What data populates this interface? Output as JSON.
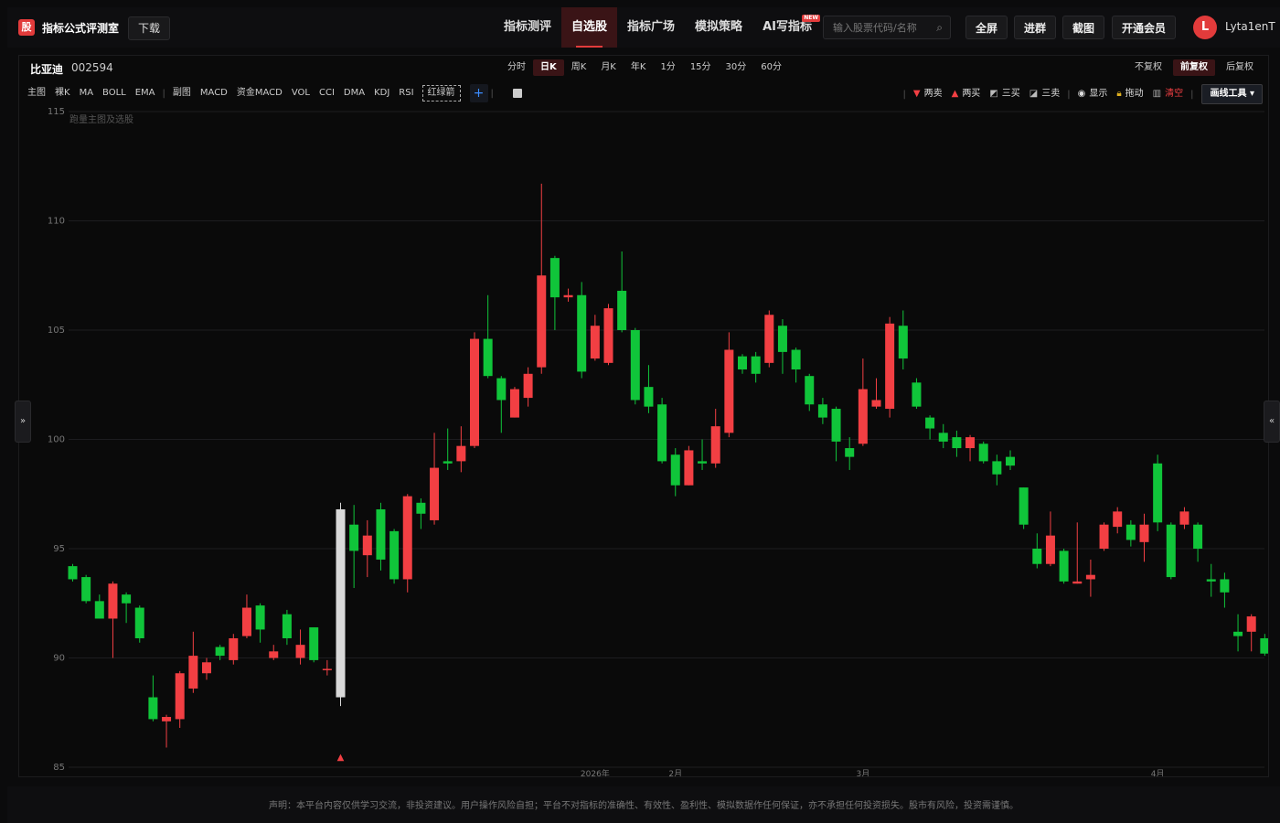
{
  "brand": {
    "logo": "股",
    "name": "指标公式评测室"
  },
  "header": {
    "download_label": "下载",
    "nav": [
      {
        "label": "指标测评",
        "active": false,
        "badge": ""
      },
      {
        "label": "自选股",
        "active": true,
        "badge": ""
      },
      {
        "label": "指标广场",
        "active": false,
        "badge": ""
      },
      {
        "label": "模拟策略",
        "active": false,
        "badge": ""
      },
      {
        "label": "AI写指标",
        "active": false,
        "badge": "NEW"
      }
    ],
    "search_placeholder": "输入股票代码/名称",
    "buttons": {
      "fullscreen": "全屏",
      "join_group": "进群",
      "screenshot": "截图",
      "vip": "开通会员"
    },
    "user": {
      "initial": "L",
      "name": "Lyta1enT"
    }
  },
  "stock": {
    "name": "比亚迪",
    "code": "002594"
  },
  "periods": [
    {
      "label": "分时",
      "active": false
    },
    {
      "label": "日K",
      "active": true
    },
    {
      "label": "周K",
      "active": false
    },
    {
      "label": "月K",
      "active": false
    },
    {
      "label": "年K",
      "active": false
    },
    {
      "label": "1分",
      "active": false
    },
    {
      "label": "15分",
      "active": false
    },
    {
      "label": "30分",
      "active": false
    },
    {
      "label": "60分",
      "active": false
    }
  ],
  "adjust": [
    {
      "label": "不复权",
      "active": false
    },
    {
      "label": "前复权",
      "active": true
    },
    {
      "label": "后复权",
      "active": false
    }
  ],
  "indicators_main": [
    "主图",
    "裸K",
    "MA",
    "BOLL",
    "EMA"
  ],
  "indicators_sub": [
    "副图",
    "MACD",
    "资金MACD",
    "VOL",
    "CCI",
    "DMA",
    "KDJ",
    "RSI"
  ],
  "indicator_dashed": "红绿箭",
  "tools": {
    "sell2": "两卖",
    "buy2": "两买",
    "buy3": "三买",
    "sell3": "三卖",
    "show": "显示",
    "drag": "拖动",
    "clear": "清空",
    "draw_tools": "画线工具"
  },
  "side": {
    "expand_left": "»",
    "expand_right": "«"
  },
  "footer": "声明：本平台内容仅供学习交流，非投资建议。用户操作风险自担；平台不对指标的准确性、有效性、盈利性、模拟数据作任何保证，亦不承担任何投资损失。股市有风险，投资需谨慎。",
  "colors": {
    "up": "#f23f43",
    "down": "#10c53a",
    "accent": "#e23b3b",
    "highlight": "#d9d9d9"
  },
  "chart_data": {
    "type": "candlestick",
    "watermark": "跑量主图及选股",
    "ylim": [
      85,
      115
    ],
    "yticks": [
      85,
      90,
      95,
      100,
      105,
      110,
      115
    ],
    "xticks": [
      {
        "label": "2026年",
        "index": 39
      },
      {
        "label": "2月",
        "index": 45
      },
      {
        "label": "3月",
        "index": 59
      },
      {
        "label": "4月",
        "index": 81
      }
    ],
    "marker": {
      "index": 20,
      "symbol": "▲",
      "color": "#f23f43"
    },
    "highlight_index": 20,
    "candles": [
      [
        94.2,
        93.6,
        94.3,
        93.5
      ],
      [
        93.7,
        92.6,
        93.8,
        92.5
      ],
      [
        92.6,
        91.8,
        92.9,
        91.8
      ],
      [
        91.8,
        93.4,
        93.5,
        90.0
      ],
      [
        92.9,
        92.5,
        93.0,
        91.6
      ],
      [
        92.3,
        90.9,
        92.4,
        90.7
      ],
      [
        88.2,
        87.2,
        89.2,
        87.1
      ],
      [
        87.1,
        87.3,
        87.4,
        85.9
      ],
      [
        87.2,
        89.3,
        89.4,
        86.8
      ],
      [
        88.6,
        90.1,
        91.2,
        88.4
      ],
      [
        89.3,
        89.8,
        90.0,
        89.0
      ],
      [
        90.5,
        90.1,
        90.6,
        89.9
      ],
      [
        89.9,
        90.9,
        91.1,
        89.7
      ],
      [
        91.0,
        92.3,
        92.9,
        90.9
      ],
      [
        92.4,
        91.3,
        92.5,
        90.7
      ],
      [
        90.0,
        90.3,
        90.6,
        89.9
      ],
      [
        92.0,
        90.9,
        92.2,
        90.6
      ],
      [
        90.0,
        90.6,
        91.3,
        89.7
      ],
      [
        91.4,
        89.9,
        91.4,
        89.8
      ],
      [
        89.5,
        89.5,
        89.9,
        89.2
      ],
      [
        96.8,
        88.2,
        97.1,
        87.8
      ],
      [
        96.1,
        94.9,
        97.0,
        93.2
      ],
      [
        94.7,
        95.6,
        96.3,
        93.7
      ],
      [
        96.8,
        94.5,
        97.1,
        94.0
      ],
      [
        95.8,
        93.6,
        95.9,
        93.4
      ],
      [
        93.6,
        97.4,
        97.5,
        93.0
      ],
      [
        97.1,
        96.6,
        97.3,
        95.9
      ],
      [
        96.3,
        98.7,
        100.3,
        96.1
      ],
      [
        99.0,
        98.9,
        100.5,
        98.6
      ],
      [
        99.0,
        99.7,
        100.6,
        98.5
      ],
      [
        99.7,
        104.6,
        104.9,
        99.6
      ],
      [
        104.6,
        102.9,
        106.6,
        102.8
      ],
      [
        102.8,
        101.8,
        102.9,
        100.3
      ],
      [
        101.0,
        102.3,
        102.4,
        101.0
      ],
      [
        101.9,
        103.0,
        103.3,
        101.5
      ],
      [
        103.3,
        107.5,
        111.7,
        103.0
      ],
      [
        108.3,
        106.5,
        108.4,
        105.0
      ],
      [
        106.5,
        106.6,
        106.9,
        106.3
      ],
      [
        106.6,
        103.1,
        107.2,
        102.8
      ],
      [
        103.7,
        105.2,
        105.7,
        103.6
      ],
      [
        103.5,
        106.0,
        106.2,
        103.4
      ],
      [
        106.8,
        105.0,
        108.6,
        104.9
      ],
      [
        105.0,
        101.8,
        105.1,
        101.6
      ],
      [
        102.4,
        101.5,
        103.4,
        101.2
      ],
      [
        101.6,
        99.0,
        101.9,
        98.9
      ],
      [
        99.3,
        97.9,
        99.6,
        97.4
      ],
      [
        97.9,
        99.5,
        99.7,
        97.9
      ],
      [
        99.0,
        98.9,
        100.0,
        98.6
      ],
      [
        98.9,
        100.6,
        101.4,
        98.7
      ],
      [
        100.3,
        104.1,
        104.9,
        100.1
      ],
      [
        103.8,
        103.2,
        103.9,
        103.0
      ],
      [
        103.8,
        103.0,
        104.0,
        102.6
      ],
      [
        103.5,
        105.7,
        105.9,
        103.3
      ],
      [
        105.2,
        104.0,
        105.5,
        103.0
      ],
      [
        104.1,
        103.2,
        104.2,
        102.6
      ],
      [
        102.9,
        101.6,
        103.0,
        101.3
      ],
      [
        101.6,
        101.0,
        101.9,
        100.7
      ],
      [
        101.4,
        99.9,
        101.5,
        99.0
      ],
      [
        99.6,
        99.2,
        100.1,
        98.6
      ],
      [
        99.8,
        102.3,
        103.7,
        99.7
      ],
      [
        101.5,
        101.8,
        102.8,
        101.4
      ],
      [
        101.4,
        105.3,
        105.6,
        101.0
      ],
      [
        105.2,
        103.7,
        105.9,
        103.2
      ],
      [
        102.6,
        101.5,
        102.8,
        101.4
      ],
      [
        101.0,
        100.5,
        101.1,
        100.0
      ],
      [
        100.3,
        99.9,
        100.7,
        99.6
      ],
      [
        100.1,
        99.6,
        100.4,
        99.2
      ],
      [
        99.6,
        100.1,
        100.2,
        99.0
      ],
      [
        99.8,
        99.0,
        99.9,
        98.9
      ],
      [
        99.0,
        98.4,
        99.3,
        97.9
      ],
      [
        99.2,
        98.8,
        99.5,
        98.6
      ],
      [
        97.8,
        96.1,
        97.8,
        95.9
      ],
      [
        95.0,
        94.3,
        95.7,
        94.1
      ],
      [
        94.3,
        95.6,
        96.7,
        94.2
      ],
      [
        94.9,
        93.5,
        95.0,
        93.4
      ],
      [
        93.4,
        93.5,
        96.2,
        93.4
      ],
      [
        93.6,
        93.8,
        94.5,
        92.8
      ],
      [
        95.0,
        96.1,
        96.2,
        94.9
      ],
      [
        96.0,
        96.7,
        96.9,
        95.7
      ],
      [
        96.1,
        95.4,
        96.3,
        95.1
      ],
      [
        95.3,
        96.1,
        96.6,
        94.4
      ],
      [
        98.9,
        96.2,
        99.3,
        95.8
      ],
      [
        96.1,
        93.7,
        96.2,
        93.6
      ],
      [
        96.1,
        96.7,
        96.9,
        95.9
      ],
      [
        96.1,
        95.0,
        96.2,
        94.4
      ],
      [
        93.6,
        93.5,
        94.3,
        92.8
      ],
      [
        93.6,
        93.0,
        93.9,
        92.3
      ],
      [
        91.2,
        91.0,
        92.0,
        90.3
      ],
      [
        91.2,
        91.9,
        92.0,
        90.3
      ],
      [
        90.9,
        90.2,
        91.1,
        90.1
      ],
      [
        89.3,
        88.4,
        90.1,
        88.2
      ]
    ]
  }
}
